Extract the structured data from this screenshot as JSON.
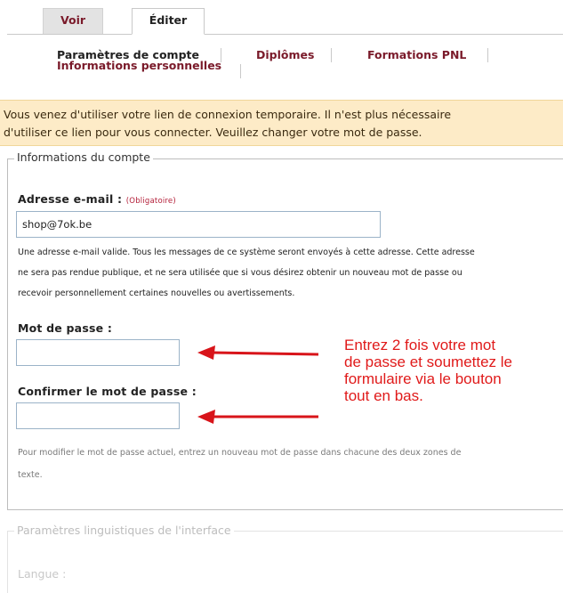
{
  "tabs": {
    "voir": "Voir",
    "editer": "Éditer"
  },
  "subtabs": {
    "compte": "Paramètres de compte",
    "info": "Informations personnelles",
    "diplomes": "Diplômes",
    "formations": "Formations PNL"
  },
  "notice": {
    "line1": "Vous venez d'utiliser votre lien de connexion temporaire. Il n'est plus nécessaire",
    "line2": "d'utiliser ce lien pour vous connecter. Veuillez changer votre mot de passe."
  },
  "account": {
    "legend": "Informations du compte",
    "email_label": "Adresse e-mail : ",
    "email_required": "(Obligatoire)",
    "email_value": "shop@7ok.be",
    "email_help_1": "Une adresse e-mail valide. Tous les messages de ce système seront envoyés à cette adresse. Cette adresse",
    "email_help_2": "ne sera pas rendue publique, et ne sera utilisée que si vous désirez obtenir un nouveau mot de passe ou",
    "email_help_3": "recevoir personnellement certaines nouvelles ou avertissements.",
    "password_label": "Mot de passe :",
    "password_value": "",
    "confirm_label": "Confirmer le mot de passe :",
    "confirm_value": "",
    "password_help_1": "Pour modifier le mot de passe actuel, entrez un nouveau mot de passe dans chacune des deux zones de",
    "password_help_2": "texte."
  },
  "annotation": {
    "line1": "Entrez 2 fois votre mot",
    "line2": "de passe et soumettez le",
    "line3": "formulaire via le bouton",
    "line4": "tout en bas."
  },
  "interface": {
    "legend": "Paramètres linguistiques de l'interface",
    "language_label": "Langue :"
  },
  "colors": {
    "annotation_red": "#e01a1a",
    "notice_bg": "#fdebc7",
    "link_maroon": "#7a1a2a"
  }
}
